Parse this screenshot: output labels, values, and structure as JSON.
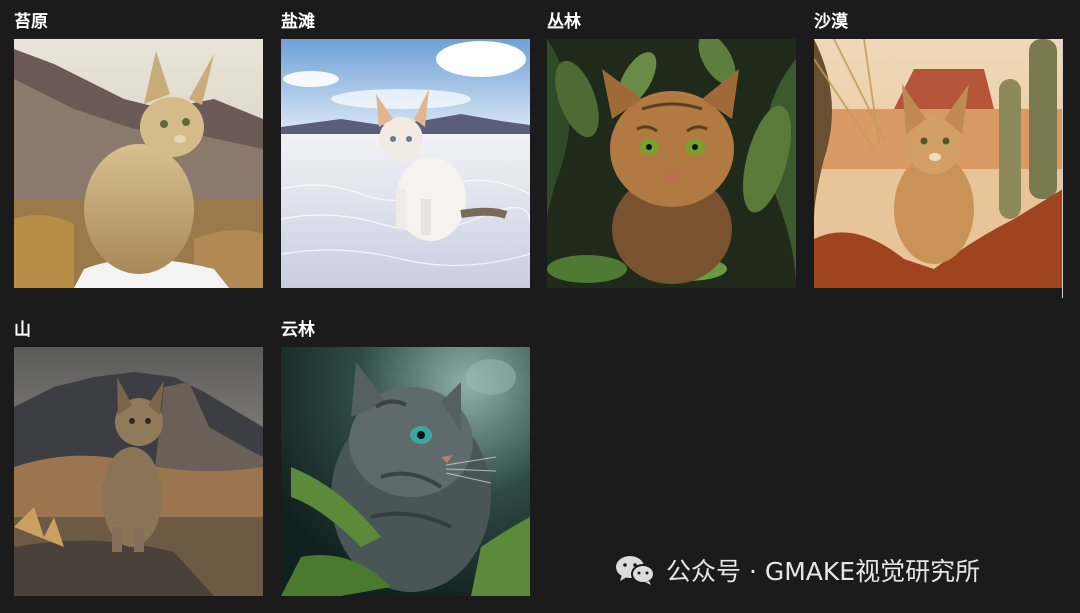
{
  "gallery": {
    "items": [
      {
        "label": "苔原"
      },
      {
        "label": "盐滩"
      },
      {
        "label": "丛林"
      },
      {
        "label": "沙漠"
      },
      {
        "label": "山"
      },
      {
        "label": "云林"
      }
    ]
  },
  "watermark": {
    "text": "公众号 · GMAKE视觉研究所",
    "icon": "wechat-logo-icon"
  }
}
